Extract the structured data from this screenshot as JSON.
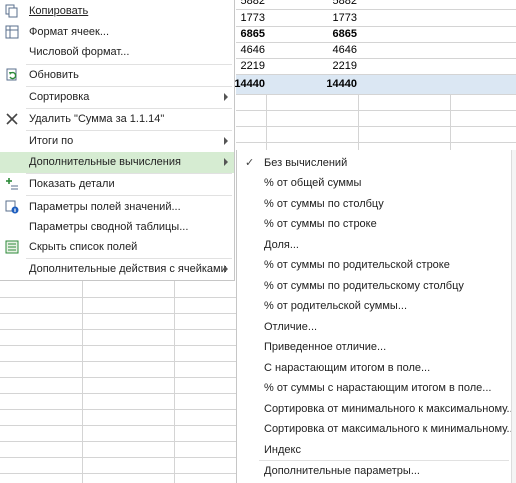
{
  "sheet": {
    "rows": [
      {
        "a": "5882",
        "b": "5882",
        "bold": false
      },
      {
        "a": "1773",
        "b": "1773",
        "bold": false
      },
      {
        "a": "6865",
        "b": "6865",
        "bold": true
      },
      {
        "a": "4646",
        "b": "4646",
        "bold": false
      },
      {
        "a": "2219",
        "b": "2219",
        "bold": false
      },
      {
        "a": "14440",
        "b": "14440",
        "bold": true
      }
    ]
  },
  "context_menu": {
    "items": [
      {
        "label": "Копировать",
        "icon": "copy-icon",
        "submenu": false
      },
      {
        "label": "Формат ячеек...",
        "icon": "format-cells-icon",
        "submenu": false
      },
      {
        "label": "Числовой формат...",
        "icon": "",
        "submenu": false
      },
      {
        "label": "Обновить",
        "icon": "refresh-icon",
        "submenu": false
      },
      {
        "label": "Сортировка",
        "icon": "",
        "submenu": true
      },
      {
        "label": "Удалить \"Сумма за 1.1.14\"",
        "icon": "remove-x-icon",
        "submenu": false
      },
      {
        "label": "Итоги по",
        "icon": "",
        "submenu": true
      },
      {
        "label": "Дополнительные вычисления",
        "icon": "",
        "submenu": true,
        "highlighted": true
      },
      {
        "label": "Показать детали",
        "icon": "show-details-icon",
        "submenu": false
      },
      {
        "label": "Параметры полей значений...",
        "icon": "field-settings-icon",
        "submenu": false
      },
      {
        "label": "Параметры сводной таблицы...",
        "icon": "",
        "submenu": false
      },
      {
        "label": "Скрыть список полей",
        "icon": "field-list-icon",
        "submenu": false
      },
      {
        "label": "Дополнительные действия с ячейками",
        "icon": "",
        "submenu": true
      }
    ]
  },
  "submenu": {
    "items": [
      {
        "label": "Без вычислений",
        "checked": true
      },
      {
        "label": "% от общей суммы",
        "checked": false
      },
      {
        "label": "% от суммы по столбцу",
        "checked": false
      },
      {
        "label": "% от суммы по строке",
        "checked": false
      },
      {
        "label": "Доля...",
        "checked": false
      },
      {
        "label": "% от суммы по родительской строке",
        "checked": false
      },
      {
        "label": "% от суммы по родительскому столбцу",
        "checked": false
      },
      {
        "label": "% от родительской суммы...",
        "checked": false
      },
      {
        "label": "Отличие...",
        "checked": false
      },
      {
        "label": "Приведенное отличие...",
        "checked": false
      },
      {
        "label": "С нарастающим итогом в поле...",
        "checked": false
      },
      {
        "label": "% от суммы с нарастающим итогом в поле...",
        "checked": false
      },
      {
        "label": "Сортировка от минимального к максимальному...",
        "checked": false
      },
      {
        "label": "Сортировка от максимального к минимальному...",
        "checked": false
      },
      {
        "label": "Индекс",
        "checked": false
      },
      {
        "label": "Дополнительные параметры...",
        "checked": false
      }
    ],
    "check_mark": "✓"
  },
  "colors": {
    "highlight": "#d6ecd2",
    "row_highlight": "#dbe7f3",
    "grid": "#d4d4d4"
  }
}
